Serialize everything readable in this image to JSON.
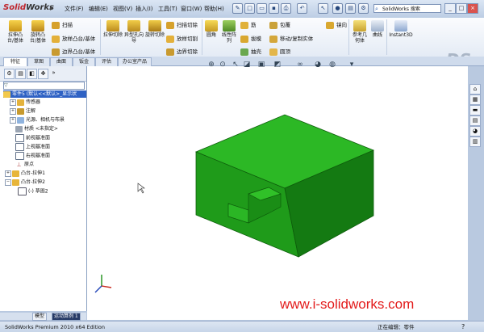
{
  "app": {
    "logo_brand": "Solid",
    "logo_rest": "Works"
  },
  "menu": [
    "文件(F)",
    "编辑(E)",
    "视图(V)",
    "插入(I)",
    "工具(T)",
    "窗口(W)",
    "帮助(H)"
  ],
  "search": {
    "placeholder": "SolidWorks 搜索"
  },
  "window_controls": [
    "_",
    "□",
    "×"
  ],
  "ribbon": {
    "extrude_boss": "拉伸凸台/基体",
    "revolve_boss": "旋转凸台/基体",
    "sweep": "扫描",
    "loft_boss": "放样凸台/基体",
    "boundary_boss": "边界凸台/基体",
    "extrude_cut": "拉伸切除",
    "hole_wizard": "异型孔向导",
    "revolve_cut": "旋转切除",
    "sweep_cut": "扫描切除",
    "loft_cut": "放样切割",
    "boundary_cut": "边界切除",
    "fillet": "圆角",
    "linear_pattern": "线性阵列",
    "rib": "筋",
    "draft": "拔模",
    "shell": "抽壳",
    "wrap": "包覆",
    "move_copy": "移动/复制实体",
    "intersect": "相交",
    "mirror": "镜向",
    "dome": "圆顶",
    "ref_geometry": "参考几何体",
    "curves": "曲线",
    "instant3d": "Instant3D"
  },
  "tabs": [
    "特征",
    "草图",
    "曲面",
    "钣金",
    "评估",
    "办公室产品"
  ],
  "tree": [
    {
      "label": "零件5 (默认<<默认>_显示状",
      "selected": true
    },
    {
      "label": "传感器"
    },
    {
      "label": "注解"
    },
    {
      "label": "光源、相机与布景"
    },
    {
      "label": "材质 <未指定>"
    },
    {
      "label": "前视基准面"
    },
    {
      "label": "上视基准面"
    },
    {
      "label": "右视基准面"
    },
    {
      "label": "原点"
    },
    {
      "label": "凸台-拉伸1"
    },
    {
      "label": "凸台-拉伸2"
    },
    {
      "label": "(-) 草图2"
    }
  ],
  "bottom_tabs": [
    "模型",
    "运动算例 1"
  ],
  "status": {
    "left": "SolidWorks Premium 2010 x64 Edition",
    "editing": "正在编辑：零件"
  },
  "watermark": "www.i-solidworks.com",
  "colors": {
    "part_green": "#22a51c",
    "part_dark": "#136d10",
    "part_top": "#2cb825",
    "watermark_red": "#e31b1b"
  },
  "icons": [
    "zoom-to-fit-icon",
    "zoom-area-icon",
    "previous-view-icon",
    "section-view-icon",
    "view-orientation-icon",
    "display-style-icon",
    "hide-show-icon",
    "edit-appearance-icon",
    "apply-scene-icon"
  ]
}
